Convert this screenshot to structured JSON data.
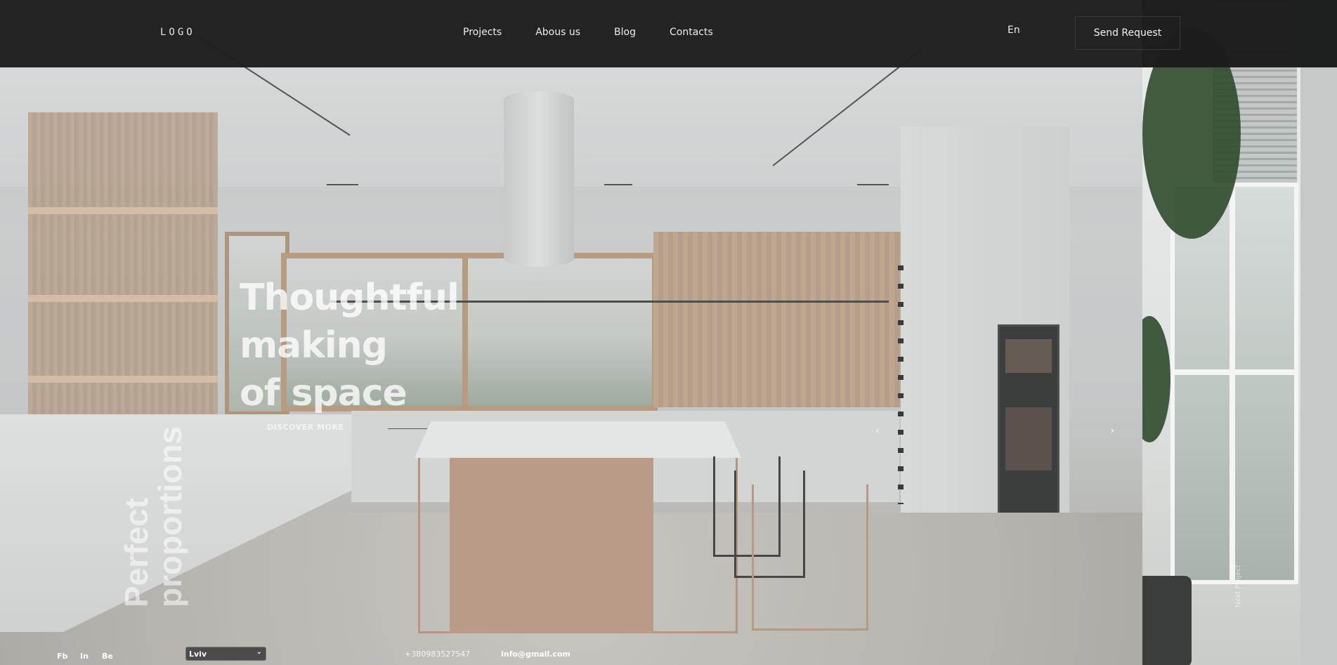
{
  "header": {
    "logo": "LOGO",
    "nav": [
      "Projects",
      "Abous us",
      "Blog",
      "Contacts"
    ],
    "language": "En",
    "send_request": "Send Request"
  },
  "hero": {
    "title_line1": "Thoughtful making",
    "title_line2": "of space",
    "discover": "DISCOVER MORE",
    "prev_icon": "chevron-left-icon",
    "next_icon": "chevron-right-icon"
  },
  "preview": {
    "label": "Next Project",
    "title_line1": "Perfect",
    "title_line2": "proportions"
  },
  "footer": {
    "social": [
      "Fb",
      "In",
      "Be"
    ],
    "city": "Lviv",
    "phone": "+380983527547",
    "email": "info@gmail.com"
  }
}
